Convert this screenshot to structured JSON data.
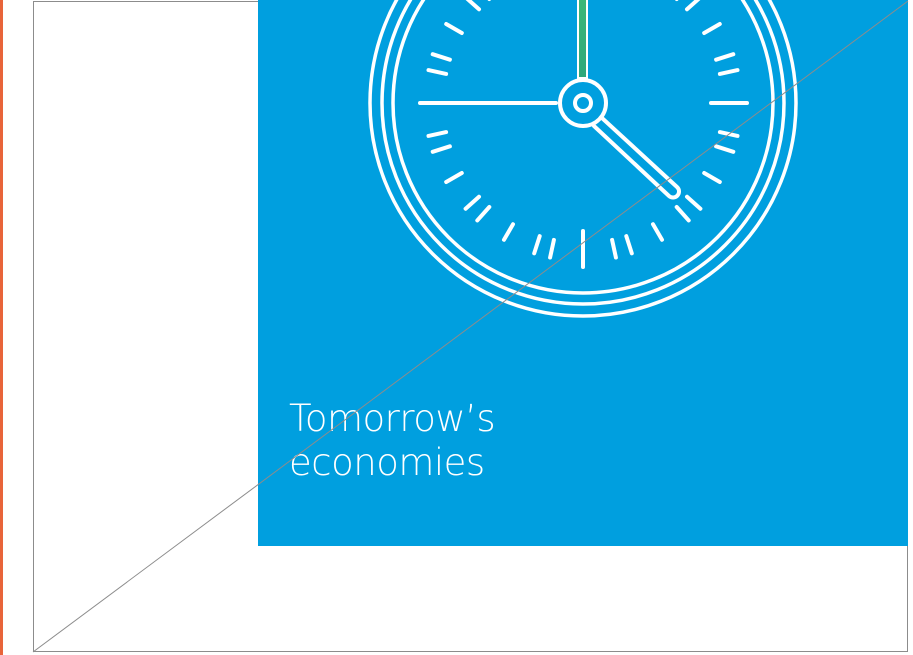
{
  "cover": {
    "title_line1": "Tomorrow’s",
    "title_line2": "economies"
  },
  "illustration": {
    "icon": "clock-icon",
    "colors": {
      "panel": "#009fdf",
      "accent_left": "#e8643a",
      "frame": "#8c8c8c",
      "second_hand": "#3cb878"
    }
  }
}
